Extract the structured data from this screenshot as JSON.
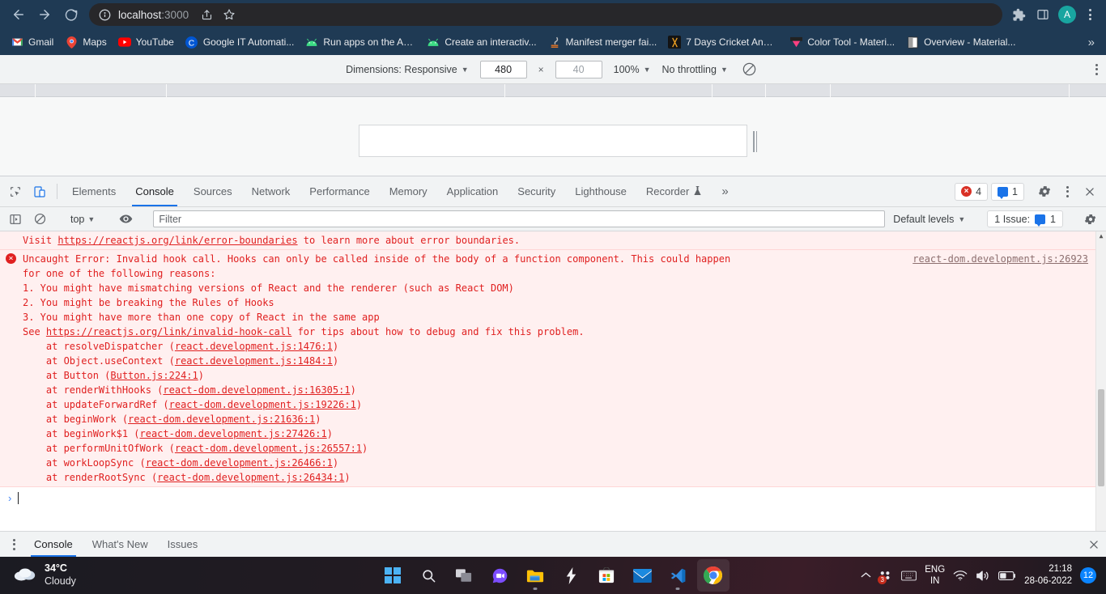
{
  "browser": {
    "back_icon": "arrow-left-icon",
    "forward_icon": "arrow-right-icon",
    "reload_icon": "reload-icon",
    "site_info_icon": "info-circle-icon",
    "url_host": "localhost",
    "url_port": ":3000",
    "share_icon": "share-icon",
    "bookmark_icon": "star-icon",
    "extensions_icon": "puzzle-icon",
    "sidepanel_icon": "side-panel-icon",
    "profile_initial": "A",
    "menu_icon": "kebab-menu-icon",
    "bookmarks": [
      {
        "label": "Gmail",
        "icon": "gmail-icon"
      },
      {
        "label": "Maps",
        "icon": "maps-icon"
      },
      {
        "label": "YouTube",
        "icon": "youtube-icon"
      },
      {
        "label": "Google IT Automati...",
        "icon": "coursera-icon"
      },
      {
        "label": "Run apps on the An...",
        "icon": "android-icon"
      },
      {
        "label": "Create an interactiv...",
        "icon": "android-icon"
      },
      {
        "label": "Manifest merger fai...",
        "icon": "stackoverflow-icon"
      },
      {
        "label": "7 Days Cricket Anal...",
        "icon": "cricket-icon"
      },
      {
        "label": "Color Tool - Materi...",
        "icon": "material-color-icon"
      },
      {
        "label": "Overview - Material...",
        "icon": "material-icon"
      }
    ],
    "bookmarks_overflow": "»"
  },
  "device_toolbar": {
    "dimensions_label": "Dimensions: Responsive",
    "width_value": "480",
    "height_value": "40",
    "multiply_symbol": "×",
    "zoom_label": "100%",
    "throttling_label": "No throttling",
    "rotate_icon": "rotate-device-icon",
    "more_options_icon": "kebab-menu-icon"
  },
  "devtools": {
    "inspect_icon": "inspect-element-icon",
    "device_toolbar_icon": "device-toggle-icon",
    "tabs": [
      {
        "label": "Elements",
        "active": false
      },
      {
        "label": "Console",
        "active": true
      },
      {
        "label": "Sources",
        "active": false
      },
      {
        "label": "Network",
        "active": false
      },
      {
        "label": "Performance",
        "active": false
      },
      {
        "label": "Memory",
        "active": false
      },
      {
        "label": "Application",
        "active": false
      },
      {
        "label": "Security",
        "active": false
      },
      {
        "label": "Lighthouse",
        "active": false
      },
      {
        "label": "Recorder",
        "active": false
      }
    ],
    "recorder_flask_icon": "flask-icon",
    "more_tabs_icon": "»",
    "error_count": "4",
    "message_count": "1",
    "settings_icon": "gear-icon",
    "more_icon": "kebab-menu-icon",
    "close_icon": "close-icon",
    "console_bar": {
      "sidebar_icon": "console-sidebar-icon",
      "clear_icon": "clear-console-icon",
      "context_label": "top",
      "eye_icon": "live-expression-icon",
      "filter_placeholder": "Filter",
      "filter_value": "",
      "levels_label": "Default levels",
      "issues_label": "1 Issue:",
      "issues_count": "1",
      "console_settings_icon": "gear-icon"
    },
    "messages": [
      {
        "id": "error-boundaries",
        "has_icon": false,
        "source": "",
        "lines": [
          [
            {
              "t": "Visit ",
              "link": false
            },
            {
              "t": "https://reactjs.org/link/error-boundaries",
              "link": true
            },
            {
              "t": " to learn more about error boundaries.",
              "link": false
            }
          ]
        ]
      },
      {
        "id": "invalid-hook-call",
        "has_icon": true,
        "icon": "error-icon",
        "source": "react-dom.development.js:26923",
        "lines": [
          [
            {
              "t": "Uncaught Error: Invalid hook call. Hooks can only be called inside of the body of a function component. This could happen",
              "link": false
            }
          ],
          [
            {
              "t": "for one of the following reasons:",
              "link": false
            }
          ],
          [
            {
              "t": "1. You might have mismatching versions of React and the renderer (such as React DOM)",
              "link": false
            }
          ],
          [
            {
              "t": "2. You might be breaking the Rules of Hooks",
              "link": false
            }
          ],
          [
            {
              "t": "3. You might have more than one copy of React in the same app",
              "link": false
            }
          ],
          [
            {
              "t": "See ",
              "link": false
            },
            {
              "t": "https://reactjs.org/link/invalid-hook-call",
              "link": true
            },
            {
              "t": " for tips about how to debug and fix this problem.",
              "link": false
            }
          ],
          [
            {
              "t": "    at resolveDispatcher (",
              "link": false
            },
            {
              "t": "react.development.js:1476:1",
              "link": true
            },
            {
              "t": ")",
              "link": false
            }
          ],
          [
            {
              "t": "    at Object.useContext (",
              "link": false
            },
            {
              "t": "react.development.js:1484:1",
              "link": true
            },
            {
              "t": ")",
              "link": false
            }
          ],
          [
            {
              "t": "    at Button (",
              "link": false
            },
            {
              "t": "Button.js:224:1",
              "link": true
            },
            {
              "t": ")",
              "link": false
            }
          ],
          [
            {
              "t": "    at renderWithHooks (",
              "link": false
            },
            {
              "t": "react-dom.development.js:16305:1",
              "link": true
            },
            {
              "t": ")",
              "link": false
            }
          ],
          [
            {
              "t": "    at updateForwardRef (",
              "link": false
            },
            {
              "t": "react-dom.development.js:19226:1",
              "link": true
            },
            {
              "t": ")",
              "link": false
            }
          ],
          [
            {
              "t": "    at beginWork (",
              "link": false
            },
            {
              "t": "react-dom.development.js:21636:1",
              "link": true
            },
            {
              "t": ")",
              "link": false
            }
          ],
          [
            {
              "t": "    at beginWork$1 (",
              "link": false
            },
            {
              "t": "react-dom.development.js:27426:1",
              "link": true
            },
            {
              "t": ")",
              "link": false
            }
          ],
          [
            {
              "t": "    at performUnitOfWork (",
              "link": false
            },
            {
              "t": "react-dom.development.js:26557:1",
              "link": true
            },
            {
              "t": ")",
              "link": false
            }
          ],
          [
            {
              "t": "    at workLoopSync (",
              "link": false
            },
            {
              "t": "react-dom.development.js:26466:1",
              "link": true
            },
            {
              "t": ")",
              "link": false
            }
          ],
          [
            {
              "t": "    at renderRootSync (",
              "link": false
            },
            {
              "t": "react-dom.development.js:26434:1",
              "link": true
            },
            {
              "t": ")",
              "link": false
            }
          ]
        ]
      }
    ],
    "prompt_arrow": "›",
    "prompt_value": "",
    "drawer": {
      "menu_icon": "kebab-menu-icon",
      "tabs": [
        {
          "label": "Console",
          "active": true
        },
        {
          "label": "What's New",
          "active": false
        },
        {
          "label": "Issues",
          "active": false
        }
      ],
      "close_icon": "close-icon"
    }
  },
  "taskbar": {
    "weather_icon": "cloud-icon",
    "weather_temp": "34°C",
    "weather_condition": "Cloudy",
    "apps": [
      {
        "name": "start-button",
        "icon": "windows-logo-icon",
        "state": ""
      },
      {
        "name": "search-button",
        "icon": "search-icon",
        "state": ""
      },
      {
        "name": "task-view-button",
        "icon": "task-view-icon",
        "state": ""
      },
      {
        "name": "chat-button",
        "icon": "chat-video-icon",
        "state": ""
      },
      {
        "name": "file-explorer-button",
        "icon": "folder-icon",
        "state": "running"
      },
      {
        "name": "flash-app-button",
        "icon": "lightning-bolt-icon",
        "state": ""
      },
      {
        "name": "microsoft-store-button",
        "icon": "store-icon",
        "state": ""
      },
      {
        "name": "mail-button",
        "icon": "mail-envelope-icon",
        "state": ""
      },
      {
        "name": "vscode-button",
        "icon": "vscode-icon",
        "state": "running"
      },
      {
        "name": "chrome-button",
        "icon": "chrome-icon",
        "state": "active"
      }
    ],
    "tray": {
      "overflow_icon": "chevron-up-icon",
      "hidden_icons_badge": "3",
      "keyboard_icon": "keyboard-icon",
      "lang_primary": "ENG",
      "lang_secondary": "IN",
      "wifi_icon": "wifi-icon",
      "volume_icon": "speaker-icon",
      "battery_icon": "battery-icon",
      "time": "21:18",
      "date": "28-06-2022",
      "notification_count": "12"
    }
  }
}
